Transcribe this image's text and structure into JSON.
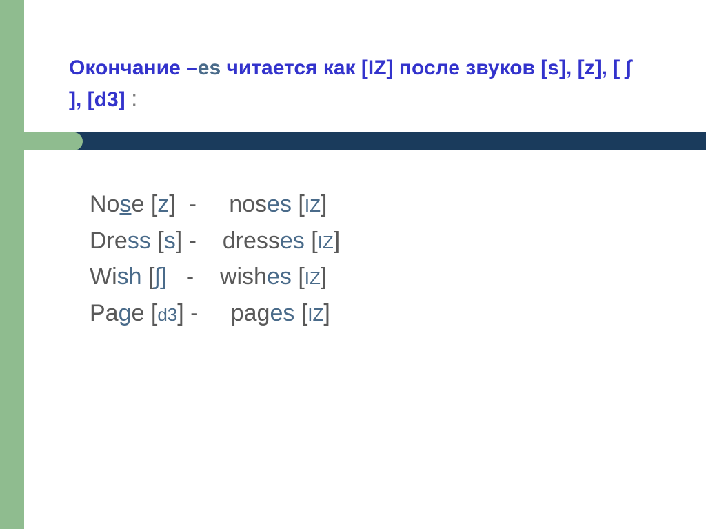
{
  "title": {
    "part1": "Окончание ",
    "dash": "–",
    "es": "es",
    "part2": " читается как [IZ] после звуков [s], [z], [ ∫ ], [d3]  ",
    "colon": ":"
  },
  "rows": [
    {
      "word_pre": "No",
      "word_hl": "s",
      "word_post": "e",
      "snd_open": " [",
      "snd": "z",
      "snd_close": "]",
      "sep": "  -     ",
      "pl_pre": "nos",
      "pl_hl": "es",
      "pl_post": "",
      "pl_open": " [",
      "pl_snd": "IZ",
      "pl_close": "]"
    },
    {
      "word_pre": "Dre",
      "word_hl": "ss",
      "word_post": "",
      "snd_open": " [",
      "snd": "s",
      "snd_close": "]",
      "sep": " -    ",
      "pl_pre": "dress",
      "pl_hl": "es",
      "pl_post": "",
      "pl_open": " [",
      "pl_snd": "IZ",
      "pl_close": "]"
    },
    {
      "word_pre": "Wi",
      "word_hl": "sh",
      "word_post": "",
      "snd_open": " [",
      "snd": "ʃ]",
      "snd_close": "",
      "sep": "   -    ",
      "pl_pre": "wish",
      "pl_hl": "es",
      "pl_post": "",
      "pl_open": " [",
      "pl_snd": "IZ",
      "pl_close": "]"
    },
    {
      "word_pre": "Pa",
      "word_hl": "g",
      "word_post": "e",
      "snd_open": " [",
      "snd": "d3",
      "snd_close": "]",
      "sep": " -     ",
      "pl_pre": "pag",
      "pl_hl": "es",
      "pl_post": "",
      "pl_open": " [",
      "pl_snd": "IZ",
      "pl_close": "]"
    }
  ]
}
